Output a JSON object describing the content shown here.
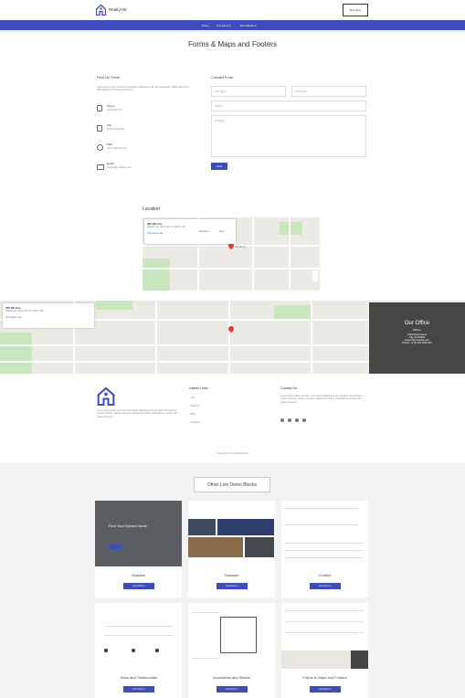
{
  "header": {
    "logo_text": "RealtyAM",
    "buy_label": "Buy Now"
  },
  "nav": {
    "items": [
      "Home",
      "Live Demo ▾",
      "More Blocks ▾"
    ]
  },
  "page_title": "Forms & Maps and Footers",
  "find_us": {
    "heading": "Find Us There",
    "intro": "Lorem ipsum dolor sit amet consectetur adipisicing elit. Ea consectetur officia dolor illum laboriosam sint to accusamus iste.",
    "items": [
      {
        "icon": "phone-icon",
        "title": "Phone",
        "value": "0123 123 123"
      },
      {
        "icon": "fax-icon",
        "title": "Fax",
        "value": "0123 1234 1234"
      },
      {
        "icon": "globe-icon",
        "title": "Web",
        "value": "www.mobirise.com"
      },
      {
        "icon": "mail-icon",
        "title": "Email",
        "value": "support@mobirise.com"
      }
    ]
  },
  "contact_form": {
    "heading": "Contact Form",
    "name_placeholder": "Your Name",
    "email_placeholder": "Your Email",
    "subject_placeholder": "Subject",
    "message_placeholder": "Message",
    "send_label": "Send"
  },
  "location": {
    "heading": "Location"
  },
  "map_card": {
    "name": "356 9th Ave",
    "address": "356 9th Ave, New York, NY 10116, USA",
    "link": "View larger map",
    "directions": "Directions",
    "save": "Save"
  },
  "office": {
    "title": "Our Office",
    "subtitle": "Address:",
    "address_line1": "1234 Street Name",
    "address_line2": "City, AA 99999",
    "email": "support@mobirise.com",
    "phone": "Phone: +1 (0) 000 0000 001"
  },
  "footer": {
    "about": "Lorem ipsum dolor sit amet consectetur adipiscing elit. Ad dolor accusantium tenetur nihil illo, veniam nesciunt, aliquid ea quidem voluptatibus veniam nihil eaque laborum.",
    "helpful_heading": "Helpful Links",
    "helpful_links": [
      "Info",
      "Features",
      "Blog",
      "Contacts"
    ],
    "contact_heading": "Contact Us",
    "contact_text": "Lorem ipsum dolor sit amet, consectetur adipisicing elit. Ad dolor accusantium tenetur nihil illo, veniam nesciunt, aliquid ea quidem voluptatibus veniam nihil eaque laborum.",
    "copyright": "Copyright (c) 2018 Mobirise"
  },
  "demo": {
    "heading": "Other Live Demo Blocks",
    "hero_caption": "Find Your Dream Home",
    "cards": [
      {
        "label": "Headers",
        "button": "Live Demo  ›"
      },
      {
        "label": "Features",
        "button": "Live Demo  ›"
      },
      {
        "label": "Content",
        "button": "Live Demo  ›"
      },
      {
        "label": "Team and Testimonials",
        "button": "Live Demo  ›"
      },
      {
        "label": "Accordions and Sliders",
        "button": "Live Demo  ›"
      },
      {
        "label": "Forms & Maps and Footers",
        "button": "Live Demo  ›"
      }
    ]
  },
  "colors": {
    "accent": "#3d4cbf",
    "office_bg": "#373737"
  }
}
